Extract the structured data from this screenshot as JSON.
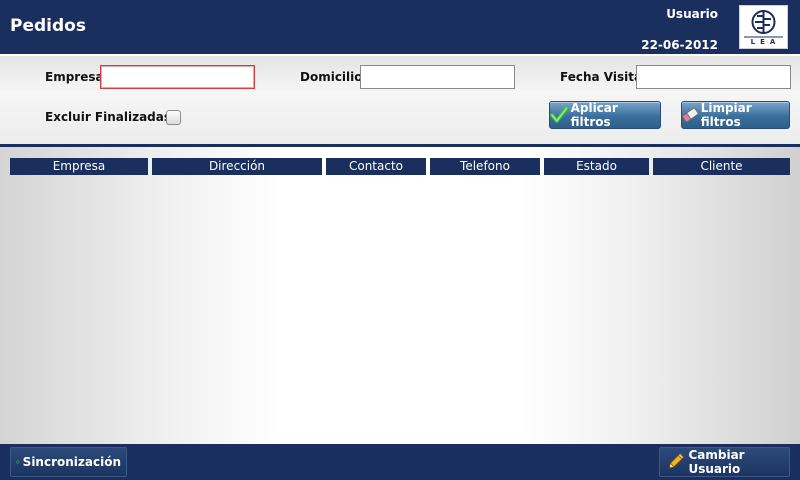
{
  "header": {
    "title": "Pedidos",
    "user": "Usuario",
    "date": "22-06-2012",
    "logo_text": "LEA"
  },
  "filters": {
    "empresa_label": "Empresa",
    "empresa_value": "",
    "domicilio_label": "Domicilio",
    "domicilio_value": "",
    "fecha_label": "Fecha Visita",
    "fecha_value": "",
    "excluir_label": "Excluir Finalizadas",
    "excluir_checked": false,
    "apply_label": "Aplicar filtros",
    "clear_label": "Limpiar filtros"
  },
  "table": {
    "columns": [
      "Empresa",
      "Dirección",
      "Contacto",
      "Telefono",
      "Estado",
      "Cliente"
    ],
    "rows": []
  },
  "footer": {
    "sync_label": "Sincronización",
    "change_user_label": "Cambiar Usuario"
  },
  "colors": {
    "brand_navy": "#1b2f5e",
    "button_blue": "#3b6f9c",
    "focus_red": "#d04040"
  }
}
